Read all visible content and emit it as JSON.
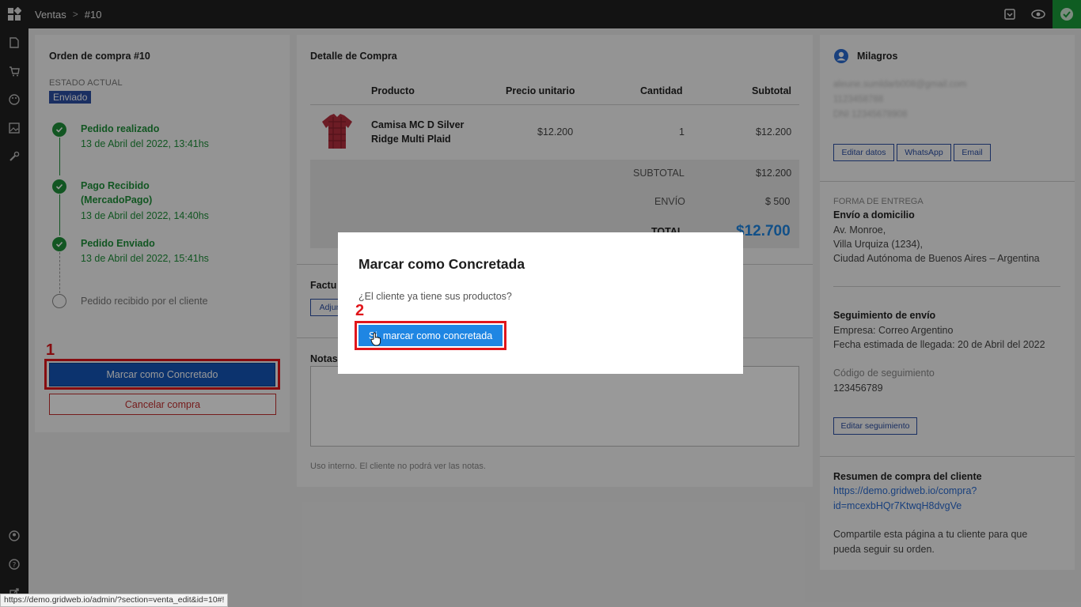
{
  "topbar": {
    "section": "Ventas",
    "separator": ">",
    "order": "#10"
  },
  "left": {
    "title": "Orden de compra #10",
    "estado_label": "ESTADO ACTUAL",
    "estado_value": "Enviado",
    "timeline": [
      {
        "title": "Pedido realizado",
        "date": "13 de Abril del 2022, 13:41hs"
      },
      {
        "title": "Pago Recibido",
        "title2": "(MercadoPago)",
        "date": "13 de Abril del 2022, 14:40hs"
      },
      {
        "title": "Pedido Enviado",
        "date": "13 de Abril del 2022, 15:41hs"
      }
    ],
    "pending": "Pedido recibido por el cliente",
    "marcar_btn": "Marcar como Concretado",
    "cancelar_btn": "Cancelar compra",
    "annotation": "1"
  },
  "middle": {
    "title": "Detalle de Compra",
    "headers": {
      "producto": "Producto",
      "precio": "Precio unitario",
      "cantidad": "Cantidad",
      "subtotal": "Subtotal"
    },
    "row": {
      "name1": "Camisa MC D Silver",
      "name2": "Ridge Multi Plaid",
      "precio": "$12.200",
      "cantidad": "1",
      "subtotal": "$12.200"
    },
    "subtotal_label": "SUBTOTAL",
    "subtotal_value": "$12.200",
    "envio_label": "ENVÍO",
    "envio_value": "$ 500",
    "total_label": "TOTAL",
    "total_value": "$12.700",
    "factura_label": "Factu",
    "adjuntar_btn": "Adjun",
    "notas_label": "Notas",
    "notas_hint": "Uso interno. El cliente no podrá ver las notas."
  },
  "right": {
    "customer": "Milagros",
    "email": "aleune.sumldarb008@gmail.com",
    "phone": "1123458788",
    "dni": "DNI 12345678908",
    "btn_editar": "Editar datos",
    "btn_whatsapp": "WhatsApp",
    "btn_email": "Email",
    "entrega_label": "FORMA DE ENTREGA",
    "entrega_tipo": "Envío a domicilio",
    "addr1": "Av. Monroe,",
    "addr2": "Villa Urquiza (1234),",
    "addr3": "Ciudad Autónoma de Buenos Aires – Argentina",
    "seguimiento_title": "Seguimiento de envío",
    "empresa": "Empresa: Correo Argentino",
    "fecha": "Fecha estimada de llegada: 20 de Abril del 2022",
    "codigo_label": "Código de seguimiento",
    "codigo": "123456789",
    "btn_editar_seg": "Editar seguimiento",
    "resumen_title": "Resumen de compra del cliente",
    "link1": "https://demo.gridweb.io/compra?",
    "link2": "id=mcexbHQr7KtwqH8dvgVe",
    "share1": "Compartile esta página a tu cliente para que",
    "share2": "pueda seguir su orden."
  },
  "modal": {
    "title": "Marcar como Concretada",
    "text": "¿El cliente ya tiene sus productos?",
    "confirm_btn": "Si, marcar como concretada",
    "annotation": "2"
  },
  "statusbar": {
    "url": "https://demo.gridweb.io/admin/?section=venta_edit&id=10#!"
  },
  "colors": {
    "accent": "#1456b8",
    "success": "#1f8f3a",
    "danger": "#e0161b",
    "total": "#1f86e3"
  }
}
